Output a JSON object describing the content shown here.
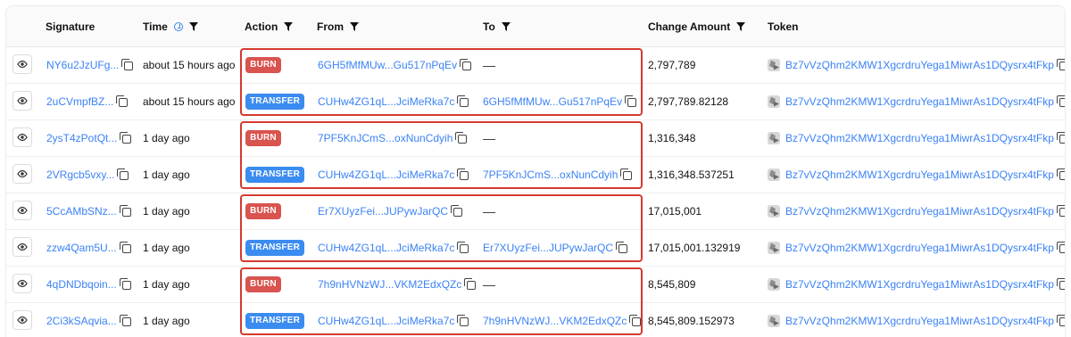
{
  "headers": {
    "signature": "Signature",
    "time": "Time",
    "action": "Action",
    "from": "From",
    "to": "To",
    "change_amount": "Change Amount",
    "token": "Token"
  },
  "rows": [
    {
      "signature": "NY6u2JzUFg...",
      "time": "about 15 hours ago",
      "action": "BURN",
      "from": "6GH5fMfMUw...Gu517nPqEv",
      "to": "—",
      "amount": "2,797,789",
      "token": "Bz7vVzQhm2KMW1XgcrdruYega1MiwrAs1DQysrx4tFkp"
    },
    {
      "signature": "2uCVmpfBZ...",
      "time": "about 15 hours ago",
      "action": "TRANSFER",
      "from": "CUHw4ZG1qL...JciMeRka7c",
      "to": "6GH5fMfMUw...Gu517nPqEv",
      "amount": "2,797,789.82128",
      "token": "Bz7vVzQhm2KMW1XgcrdruYega1MiwrAs1DQysrx4tFkp"
    },
    {
      "signature": "2ysT4zPotQt...",
      "time": "1 day ago",
      "action": "BURN",
      "from": "7PF5KnJCmS...oxNunCdyih",
      "to": "—",
      "amount": "1,316,348",
      "token": "Bz7vVzQhm2KMW1XgcrdruYega1MiwrAs1DQysrx4tFkp"
    },
    {
      "signature": "2VRgcb5vxy...",
      "time": "1 day ago",
      "action": "TRANSFER",
      "from": "CUHw4ZG1qL...JciMeRka7c",
      "to": "7PF5KnJCmS...oxNunCdyih",
      "amount": "1,316,348.537251",
      "token": "Bz7vVzQhm2KMW1XgcrdruYega1MiwrAs1DQysrx4tFkp"
    },
    {
      "signature": "5CcAMbSNz...",
      "time": "1 day ago",
      "action": "BURN",
      "from": "Er7XUyzFei...JUPywJarQC",
      "to": "—",
      "amount": "17,015,001",
      "token": "Bz7vVzQhm2KMW1XgcrdruYega1MiwrAs1DQysrx4tFkp"
    },
    {
      "signature": "zzw4Qam5U...",
      "time": "1 day ago",
      "action": "TRANSFER",
      "from": "CUHw4ZG1qL...JciMeRka7c",
      "to": "Er7XUyzFei...JUPywJarQC",
      "amount": "17,015,001.132919",
      "token": "Bz7vVzQhm2KMW1XgcrdruYega1MiwrAs1DQysrx4tFkp"
    },
    {
      "signature": "4qDNDbqoin...",
      "time": "1 day ago",
      "action": "BURN",
      "from": "7h9nHVNzWJ...VKM2EdxQZc",
      "to": "—",
      "amount": "8,545,809",
      "token": "Bz7vVzQhm2KMW1XgcrdruYega1MiwrAs1DQysrx4tFkp"
    },
    {
      "signature": "2Ci3kSAqvia...",
      "time": "1 day ago",
      "action": "TRANSFER",
      "from": "CUHw4ZG1qL...JciMeRka7c",
      "to": "7h9nHVNzWJ...VKM2EdxQZc",
      "amount": "8,545,809.152973",
      "token": "Bz7vVzQhm2KMW1XgcrdruYega1MiwrAs1DQysrx4tFkp"
    }
  ],
  "colors": {
    "link": "#3b82f6",
    "burn_badge": "#d9534f",
    "transfer_badge": "#3b8cf0",
    "highlight_box": "#d53a2f"
  }
}
